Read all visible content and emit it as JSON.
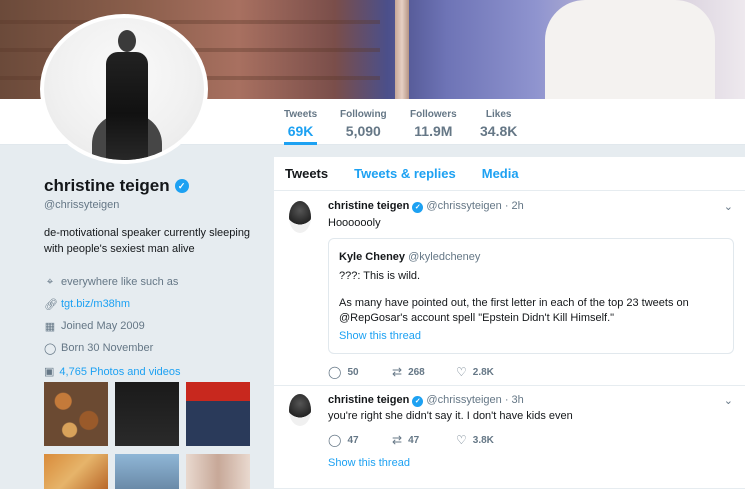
{
  "stats": [
    {
      "label": "Tweets",
      "value": "69K"
    },
    {
      "label": "Following",
      "value": "5,090"
    },
    {
      "label": "Followers",
      "value": "11.9M"
    },
    {
      "label": "Likes",
      "value": "34.8K"
    }
  ],
  "profile": {
    "name": "christine teigen",
    "handle": "@chrissyteigen",
    "bio": "de-motivational speaker currently sleeping with people's sexiest man alive",
    "location": "everywhere like such as",
    "url": "tgt.biz/m38hm",
    "joined": "Joined May 2009",
    "born": "Born 30 November",
    "photos_link": "4,765 Photos and videos"
  },
  "tabs": [
    "Tweets",
    "Tweets & replies",
    "Media"
  ],
  "tweets": [
    {
      "name": "christine teigen",
      "meta": "@chrissyteigen · 2h",
      "text": "Hooooooly",
      "quote": {
        "name": "Kyle Cheney",
        "handle": "@kyledcheney",
        "line1": "???: This is wild.",
        "line2": "As many have pointed out, the first letter in each of the top 23 tweets on @RepGosar's account spell \"Epstein Didn't Kill Himself.\"",
        "show": "Show this thread"
      },
      "replies": "50",
      "retweets": "268",
      "likes": "2.8K"
    },
    {
      "name": "christine teigen",
      "meta": "@chrissyteigen · 3h",
      "text": "you're right she didn't say it. I don't have kids even",
      "replies": "47",
      "retweets": "47",
      "likes": "3.8K",
      "show": "Show this thread"
    }
  ],
  "colors": {
    "accent": "#1da1f2",
    "muted": "#657786",
    "background": "#e6ecf0"
  }
}
